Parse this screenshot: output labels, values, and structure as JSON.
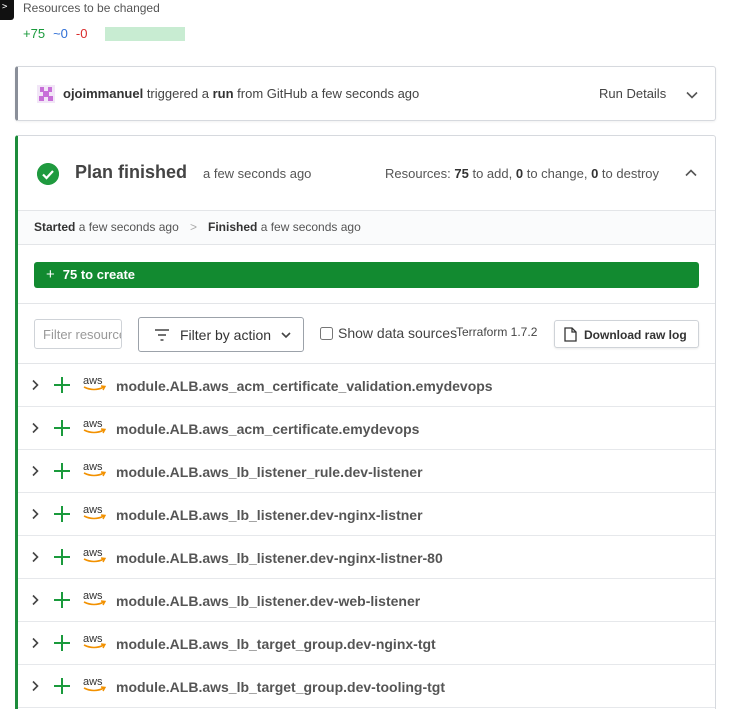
{
  "resources_summary": {
    "title": "Resources to be changed",
    "add": "+75",
    "change": "~0",
    "destroy": "-0"
  },
  "trigger": {
    "user": "ojoimmanuel",
    "text_triggered": "triggered a",
    "run_word": "run",
    "text_from": "from GitHub a few seconds ago",
    "details_label": "Run Details"
  },
  "plan": {
    "title": "Plan finished",
    "time": "a few seconds ago",
    "summary_prefix": "Resources:",
    "add_count": "75",
    "add_text": "to add,",
    "change_count": "0",
    "change_text": "to change,",
    "destroy_count": "0",
    "destroy_text": "to destroy"
  },
  "timeline": {
    "started_label": "Started",
    "started_time": "a few seconds ago",
    "separator": ">",
    "finished_label": "Finished",
    "finished_time": "a few seconds ago"
  },
  "create_bar": {
    "label": "75 to create"
  },
  "filters": {
    "search_placeholder": "Filter resources",
    "filter_action_label": "Filter by action",
    "show_data_sources_label": "Show data sources",
    "terraform_version": "Terraform 1.7.2",
    "download_label": "Download raw log"
  },
  "resources": [
    "module.ALB.aws_acm_certificate_validation.emydevops",
    "module.ALB.aws_acm_certificate.emydevops",
    "module.ALB.aws_lb_listener_rule.dev-listener",
    "module.ALB.aws_lb_listener.dev-nginx-listner",
    "module.ALB.aws_lb_listener.dev-nginx-listner-80",
    "module.ALB.aws_lb_listener.dev-web-listener",
    "module.ALB.aws_lb_target_group.dev-nginx-tgt",
    "module.ALB.aws_lb_target_group.dev-tooling-tgt"
  ],
  "aws_logo_text": "aws",
  "colors": {
    "accent_green": "#128a30",
    "add_green": "#1a9a3c",
    "change_blue": "#2f6fd6",
    "destroy_red": "#d92b2b"
  }
}
